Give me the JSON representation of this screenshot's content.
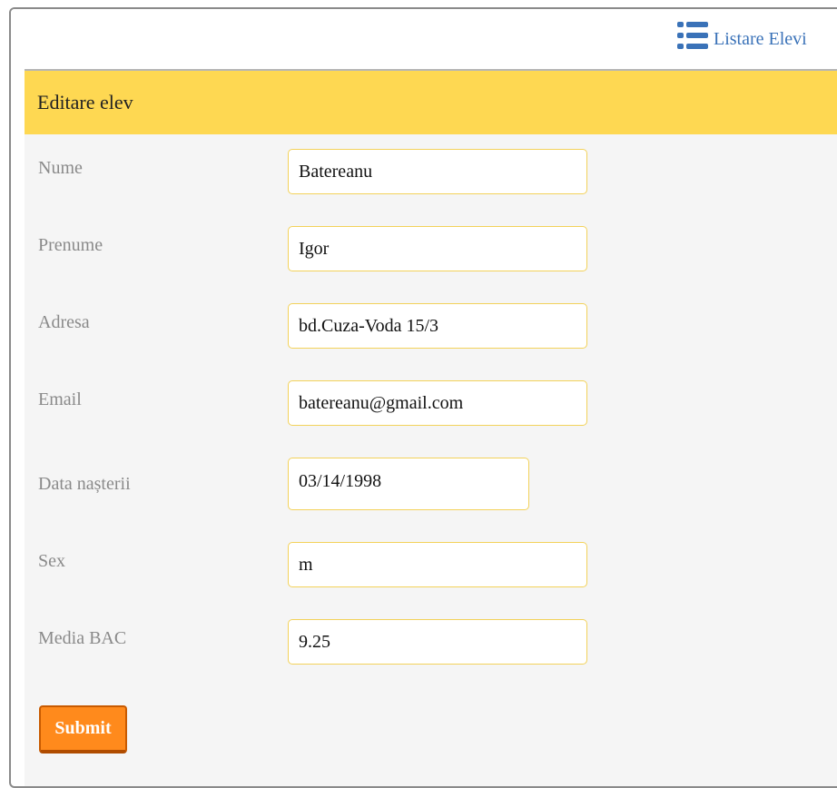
{
  "nav": {
    "list_link_label": "Listare Elevi",
    "list_icon": "list-icon"
  },
  "header": {
    "title": "Editare elev"
  },
  "form": {
    "fields": [
      {
        "label": "Nume",
        "value": "Batereanu"
      },
      {
        "label": "Prenume",
        "value": "Igor"
      },
      {
        "label": "Adresa",
        "value": "bd.Cuza-Voda 15/3"
      },
      {
        "label": "Email",
        "value": "batereanu@gmail.com"
      },
      {
        "label": "Data nașterii",
        "value": "03/14/1998"
      },
      {
        "label": "Sex",
        "value": "m"
      },
      {
        "label": "Media BAC",
        "value": "9.25"
      }
    ],
    "submit_label": "Submit"
  },
  "colors": {
    "header_bg": "#fed852",
    "form_bg": "#f5f5f5",
    "input_border": "#f3d25a",
    "submit_bg": "#ff8a1c",
    "link": "#3a72b8"
  }
}
